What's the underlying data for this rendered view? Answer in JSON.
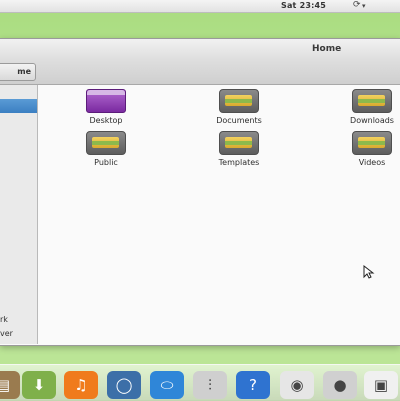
{
  "top_panel": {
    "clock": "Sat 23:45",
    "sync_icon": "⟳",
    "arrow_icon": "▾"
  },
  "window": {
    "title": "Home",
    "breadcrumb": "me"
  },
  "sidebar": {
    "items": [
      {
        "label": "rk"
      },
      {
        "label": "ver"
      }
    ]
  },
  "files": [
    {
      "name": "Desktop",
      "icon": "desktop-icon"
    },
    {
      "name": "Documents",
      "icon": "folder-icon"
    },
    {
      "name": "Downloads",
      "icon": "folder-icon"
    },
    {
      "name": "Public",
      "icon": "folder-icon"
    },
    {
      "name": "Templates",
      "icon": "folder-icon"
    },
    {
      "name": "Videos",
      "icon": "folder-icon"
    }
  ],
  "dock": {
    "items": [
      {
        "name": "files",
        "glyph": "▤",
        "color": "#9a7b4f"
      },
      {
        "name": "downloads",
        "glyph": "⬇",
        "color": "#7fb04a"
      },
      {
        "name": "music",
        "glyph": "♫",
        "color": "#f07b1c"
      },
      {
        "name": "web",
        "glyph": "◯",
        "color": "#3c6fa8"
      },
      {
        "name": "switch",
        "glyph": "⬭",
        "color": "#2f86d8"
      },
      {
        "name": "settings",
        "glyph": "⫶",
        "color": "#cfcfcf"
      },
      {
        "name": "help",
        "glyph": "?",
        "color": "#2f73d0"
      },
      {
        "name": "disk",
        "glyph": "◉",
        "color": "#e6e6e6"
      },
      {
        "name": "camera",
        "glyph": "●",
        "color": "#d0d0d0"
      },
      {
        "name": "photos",
        "glyph": "▣",
        "color": "#f0f0f0"
      }
    ]
  }
}
